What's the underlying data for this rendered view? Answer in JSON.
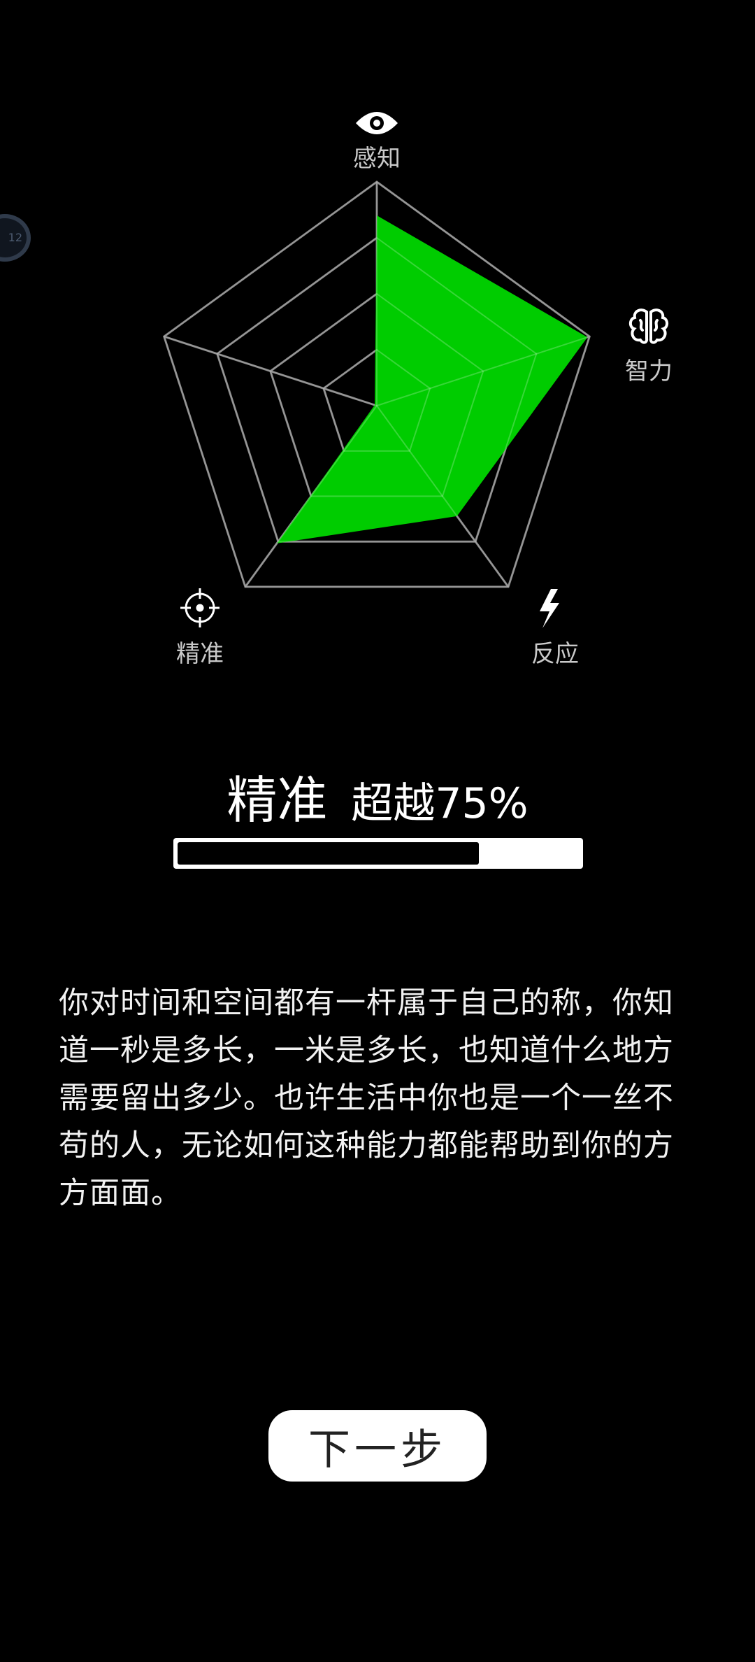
{
  "side_bubble": {
    "text": "12"
  },
  "chart_data": {
    "type": "radar",
    "axes": [
      "感知",
      "智力",
      "反应",
      "精准",
      ""
    ],
    "axis_icons": [
      "eye-icon",
      "brain-icon",
      "lightning-icon",
      "crosshair-icon",
      ""
    ],
    "rings": 4,
    "max": 100,
    "values": [
      85,
      99,
      61,
      76,
      1
    ],
    "fill_color": "#00CC00",
    "grid_color": "#7a7a7a"
  },
  "stat": {
    "name": "精准",
    "value_text": "超越75%",
    "percent": 75
  },
  "description": "你对时间和空间都有一杆属于自己的称，你知道一秒是多长，一米是多长，也知道什么地方需要留出多少。也许生活中你也是一个一丝不苟的人，无论如何这种能力都能帮助到你的方方面面。",
  "next_button": {
    "label": "下一步"
  }
}
